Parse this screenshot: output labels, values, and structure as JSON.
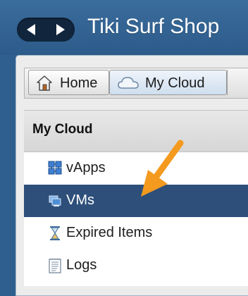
{
  "app": {
    "title": "Tiki Surf Shop"
  },
  "nav": {
    "back_icon": "back-arrow-icon",
    "forward_icon": "forward-arrow-icon"
  },
  "tabs": [
    {
      "label": "Home",
      "icon": "home-icon"
    },
    {
      "label": "My Cloud",
      "icon": "cloud-icon",
      "selected": true
    }
  ],
  "section": {
    "title": "My Cloud"
  },
  "sidebar": {
    "items": [
      {
        "label": "vApps",
        "icon": "vapps-icon"
      },
      {
        "label": "VMs",
        "icon": "vms-icon",
        "selected": true
      },
      {
        "label": "Expired Items",
        "icon": "hourglass-icon"
      },
      {
        "label": "Logs",
        "icon": "logs-icon"
      }
    ]
  },
  "annotation": {
    "color": "#f39a1f"
  },
  "colors": {
    "header": "#2f5f8f",
    "selection": "#2d4f7a",
    "nav_pill": "#11263d"
  }
}
